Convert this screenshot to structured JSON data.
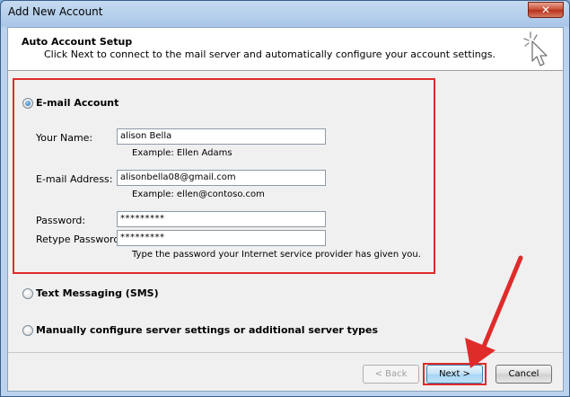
{
  "window": {
    "title": "Add New Account",
    "close_label": "✕"
  },
  "header": {
    "title": "Auto Account Setup",
    "description": "Click Next to connect to the mail server and automatically configure your account settings."
  },
  "options": {
    "email_account": "E-mail Account",
    "text_messaging": "Text Messaging (SMS)",
    "manual_config": "Manually configure server settings or additional server types"
  },
  "fields": {
    "name_label": "Your Name:",
    "name_value": "alison Bella",
    "name_example": "Example: Ellen Adams",
    "email_label": "E-mail Address:",
    "email_value": "alisonbella08@gmail.com",
    "email_example": "Example: ellen@contoso.com",
    "password_label": "Password:",
    "password_value": "*********",
    "retype_label": "Retype Password:",
    "retype_value": "*********",
    "password_hint": "Type the password your Internet service provider has given you."
  },
  "buttons": {
    "back": "< Back",
    "next": "Next >",
    "cancel": "Cancel"
  },
  "colors": {
    "highlight": "#e02b2b"
  }
}
